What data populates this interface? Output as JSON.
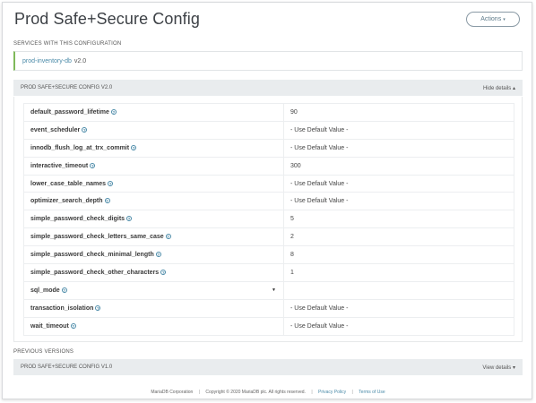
{
  "header": {
    "title": "Prod Safe+Secure Config",
    "actions_label": "Actions"
  },
  "services": {
    "section_label": "SERVICES WITH THIS CONFIGURATION",
    "items": [
      {
        "name": "prod-inventory-db",
        "version": "v2.0"
      }
    ]
  },
  "current_config": {
    "title": "PROD SAFE+SECURE CONFIG V2.0",
    "toggle_label": "Hide details",
    "rows": [
      {
        "name": "default_password_lifetime",
        "value": "90"
      },
      {
        "name": "event_scheduler",
        "value": "- Use Default Value -"
      },
      {
        "name": "innodb_flush_log_at_trx_commit",
        "value": "- Use Default Value -"
      },
      {
        "name": "interactive_timeout",
        "value": "300"
      },
      {
        "name": "lower_case_table_names",
        "value": "- Use Default Value -"
      },
      {
        "name": "optimizer_search_depth",
        "value": "- Use Default Value -"
      },
      {
        "name": "simple_password_check_digits",
        "value": "5"
      },
      {
        "name": "simple_password_check_letters_same_case",
        "value": "2"
      },
      {
        "name": "simple_password_check_minimal_length",
        "value": "8"
      },
      {
        "name": "simple_password_check_other_characters",
        "value": "1"
      },
      {
        "name": "sql_mode",
        "value": ""
      },
      {
        "name": "transaction_isolation",
        "value": "- Use Default Value -"
      },
      {
        "name": "wait_timeout",
        "value": "- Use Default Value -"
      }
    ]
  },
  "previous_versions": {
    "section_label": "PREVIOUS VERSIONS",
    "items": [
      {
        "title": "PROD SAFE+SECURE CONFIG V1.0",
        "toggle_label": "View details"
      }
    ]
  },
  "footer": {
    "company": "MariaDB Corporation",
    "copyright": "Copyright © 2020 MariaDB plc. All rights reserved.",
    "privacy": "Privacy Policy",
    "terms": "Terms of Use"
  }
}
